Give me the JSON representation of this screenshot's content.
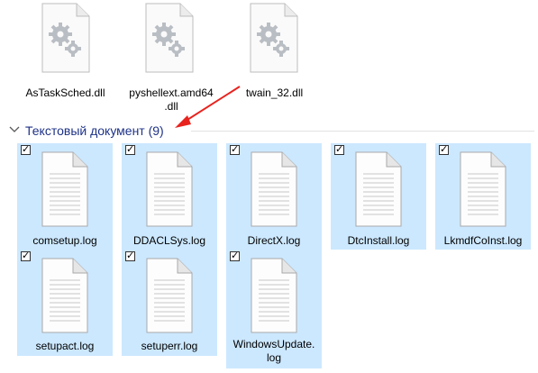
{
  "dll_files": [
    {
      "name": "AsTaskSched.dll",
      "icon": "gear-file-icon"
    },
    {
      "name": "pyshellext.amd64\n.dll",
      "icon": "gear-file-icon"
    },
    {
      "name": "twain_32.dll",
      "icon": "gear-file-icon"
    }
  ],
  "group": {
    "title": "Текстовый документ (9)",
    "title_color": "#1e3287"
  },
  "log_files": [
    {
      "name": "comsetup.log",
      "checked": true
    },
    {
      "name": "DDACLSys.log",
      "checked": true
    },
    {
      "name": "DirectX.log",
      "checked": true
    },
    {
      "name": "DtcInstall.log",
      "checked": true
    },
    {
      "name": "LkmdfCoInst.log",
      "checked": true
    },
    {
      "name": "setupact.log",
      "checked": true
    },
    {
      "name": "setuperr.log",
      "checked": true
    },
    {
      "name": "WindowsUpdate.\nlog",
      "checked": true
    }
  ],
  "checkbox_mark": "✓",
  "colors": {
    "selection": "#cce8ff",
    "arrow": "#e8231e"
  }
}
